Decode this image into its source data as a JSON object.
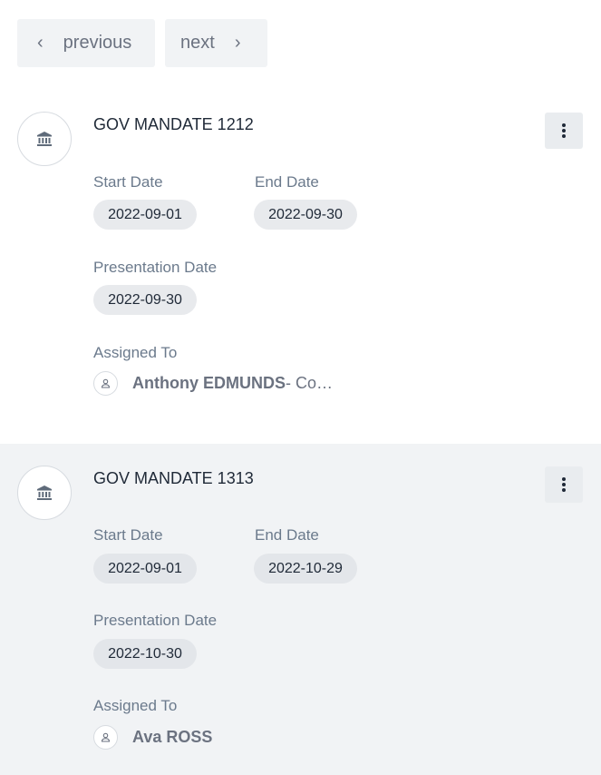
{
  "pager": {
    "previous_label": "previous",
    "next_label": "next"
  },
  "mandates": [
    {
      "title": "GOV MANDATE 1212",
      "start_label": "Start Date",
      "start_value": "2022-09-01",
      "end_label": "End Date",
      "end_value": "2022-09-30",
      "presentation_label": "Presentation Date",
      "presentation_value": "2022-09-30",
      "assigned_label": "Assigned To",
      "assignee_name": "Anthony EDMUNDS",
      "assignee_role": " - Co…"
    },
    {
      "title": "GOV MANDATE 1313",
      "start_label": "Start Date",
      "start_value": "2022-09-01",
      "end_label": "End Date",
      "end_value": "2022-10-29",
      "presentation_label": "Presentation Date",
      "presentation_value": "2022-10-30",
      "assigned_label": "Assigned To",
      "assignee_name": "Ava ROSS",
      "assignee_role": ""
    }
  ],
  "icons": {
    "card_avatar": "bank-icon",
    "menu": "kebab-menu-icon",
    "user": "user-icon",
    "prev": "chevron-left-icon",
    "next": "chevron-right-icon"
  }
}
